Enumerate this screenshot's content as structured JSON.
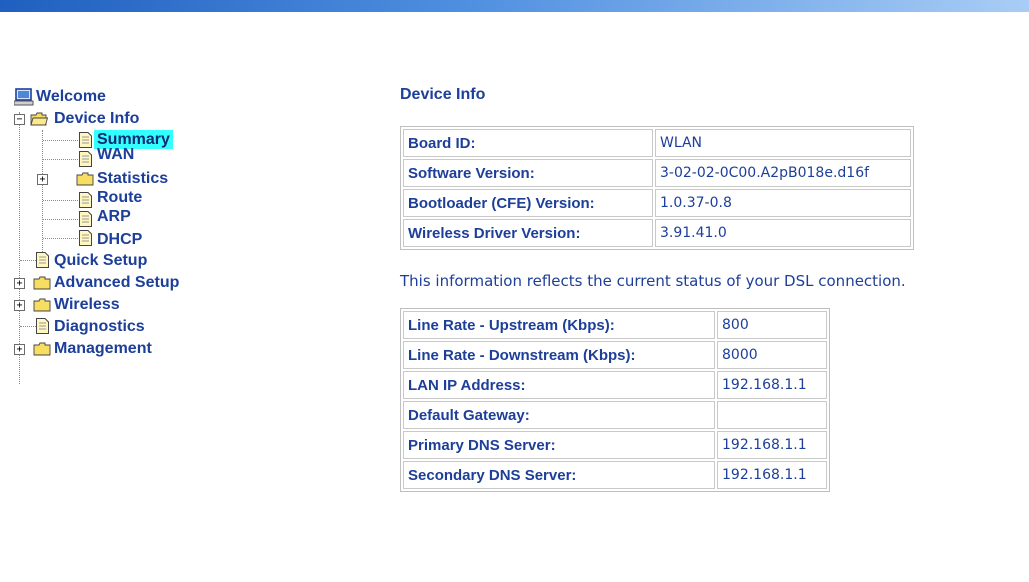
{
  "nav": {
    "welcome": "Welcome",
    "device_info": "Device Info",
    "summary": "Summary",
    "wan": "WAN",
    "statistics": "Statistics",
    "route": "Route",
    "arp": "ARP",
    "dhcp": "DHCP",
    "quick_setup": "Quick Setup",
    "advanced_setup": "Advanced Setup",
    "wireless": "Wireless",
    "diagnostics": "Diagnostics",
    "management": "Management"
  },
  "main": {
    "title": "Device Info",
    "device_table": [
      {
        "label": "Board ID:",
        "value": "WLAN"
      },
      {
        "label": "Software Version:",
        "value": "3-02-02-0C00.A2pB018e.d16f"
      },
      {
        "label": "Bootloader (CFE) Version:",
        "value": "1.0.37-0.8"
      },
      {
        "label": "Wireless Driver Version:",
        "value": "3.91.41.0"
      }
    ],
    "note": "This information reflects the current status of your DSL connection.",
    "status_table": [
      {
        "label": "Line Rate - Upstream (Kbps):",
        "value": "800"
      },
      {
        "label": "Line Rate - Downstream (Kbps):",
        "value": "8000"
      },
      {
        "label": "LAN IP Address:",
        "value": "192.168.1.1"
      },
      {
        "label": "Default Gateway:",
        "value": ""
      },
      {
        "label": "Primary DNS Server:",
        "value": "192.168.1.1"
      },
      {
        "label": "Secondary DNS Server:",
        "value": "192.168.1.1"
      }
    ]
  }
}
